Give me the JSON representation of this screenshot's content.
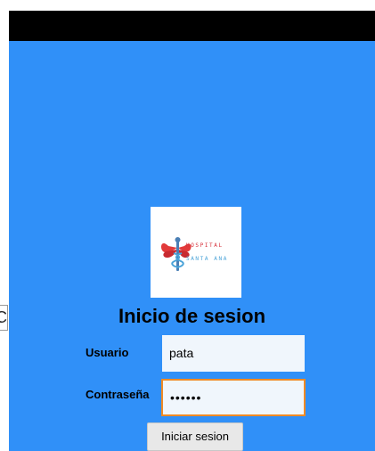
{
  "logo": {
    "line1": "HOSPITAL",
    "line2": "SANTA ANA",
    "icon": "caduceus-icon"
  },
  "login": {
    "title": "Inicio de sesion",
    "user_label": "Usuario",
    "user_value": "pata",
    "pass_label": "Contraseña",
    "pass_value": "pata12",
    "button_label": "Iniciar sesion"
  },
  "overlay": {
    "fragment_text": "C"
  },
  "colors": {
    "background": "#3090f8",
    "status_bar": "#000000",
    "field_bg": "#f0f6fc",
    "focus_border": "#f08a24",
    "logo_red": "#d6303a",
    "logo_blue": "#4aa3d8"
  }
}
